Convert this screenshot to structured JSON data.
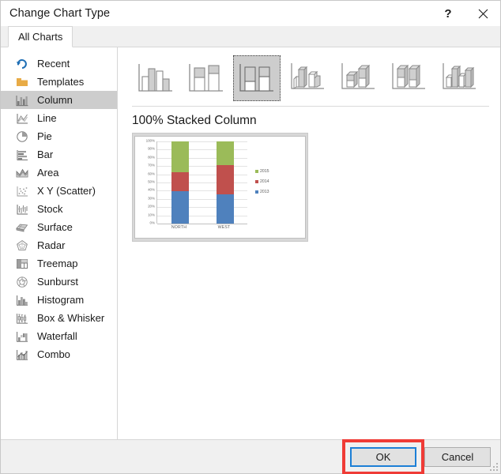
{
  "window": {
    "title": "Change Chart Type",
    "help_label": "?",
    "close_label": "✕",
    "help_icon": "question-mark-icon",
    "close_icon": "close-icon"
  },
  "tabs": [
    {
      "label": "All Charts",
      "selected": true
    }
  ],
  "sidebar": {
    "items": [
      {
        "label": "Recent",
        "icon": "recent-icon",
        "selected": false
      },
      {
        "label": "Templates",
        "icon": "templates-icon",
        "selected": false
      },
      {
        "label": "Column",
        "icon": "column-chart-icon",
        "selected": true
      },
      {
        "label": "Line",
        "icon": "line-chart-icon",
        "selected": false
      },
      {
        "label": "Pie",
        "icon": "pie-chart-icon",
        "selected": false
      },
      {
        "label": "Bar",
        "icon": "bar-chart-icon",
        "selected": false
      },
      {
        "label": "Area",
        "icon": "area-chart-icon",
        "selected": false
      },
      {
        "label": "X Y (Scatter)",
        "icon": "scatter-chart-icon",
        "selected": false
      },
      {
        "label": "Stock",
        "icon": "stock-chart-icon",
        "selected": false
      },
      {
        "label": "Surface",
        "icon": "surface-chart-icon",
        "selected": false
      },
      {
        "label": "Radar",
        "icon": "radar-chart-icon",
        "selected": false
      },
      {
        "label": "Treemap",
        "icon": "treemap-icon",
        "selected": false
      },
      {
        "label": "Sunburst",
        "icon": "sunburst-icon",
        "selected": false
      },
      {
        "label": "Histogram",
        "icon": "histogram-icon",
        "selected": false
      },
      {
        "label": "Box & Whisker",
        "icon": "box-whisker-icon",
        "selected": false
      },
      {
        "label": "Waterfall",
        "icon": "waterfall-icon",
        "selected": false
      },
      {
        "label": "Combo",
        "icon": "combo-chart-icon",
        "selected": false
      }
    ]
  },
  "subtypes": [
    {
      "name": "clustered-column",
      "selected": false
    },
    {
      "name": "stacked-column",
      "selected": false
    },
    {
      "name": "100-percent-stacked-column",
      "selected": true
    },
    {
      "name": "3d-clustered-column",
      "selected": false
    },
    {
      "name": "3d-stacked-column",
      "selected": false
    },
    {
      "name": "3d-100-percent-stacked-column",
      "selected": false
    },
    {
      "name": "3d-column",
      "selected": false
    }
  ],
  "preview": {
    "title": "100% Stacked Column"
  },
  "chart_data": {
    "type": "bar",
    "title": "100% Stacked Column",
    "subtitle": "",
    "xlabel": "",
    "ylabel": "",
    "stacked": true,
    "stack_mode": "100%",
    "grid": true,
    "legend_position": "right",
    "categories": [
      "NORTH",
      "WEST"
    ],
    "ylim": [
      0,
      100
    ],
    "yticks": [
      "0%",
      "10%",
      "20%",
      "30%",
      "40%",
      "50%",
      "60%",
      "70%",
      "80%",
      "90%",
      "100%"
    ],
    "series": [
      {
        "name": "2013",
        "color": "#4F81BD",
        "values": [
          39,
          36
        ]
      },
      {
        "name": "2014",
        "color": "#C0504D",
        "values": [
          24,
          35
        ]
      },
      {
        "name": "2015",
        "color": "#9BBB59",
        "values": [
          37,
          29
        ]
      }
    ],
    "legend_order": [
      "2015",
      "2014",
      "2013"
    ]
  },
  "footer": {
    "ok_label": "OK",
    "cancel_label": "Cancel"
  }
}
